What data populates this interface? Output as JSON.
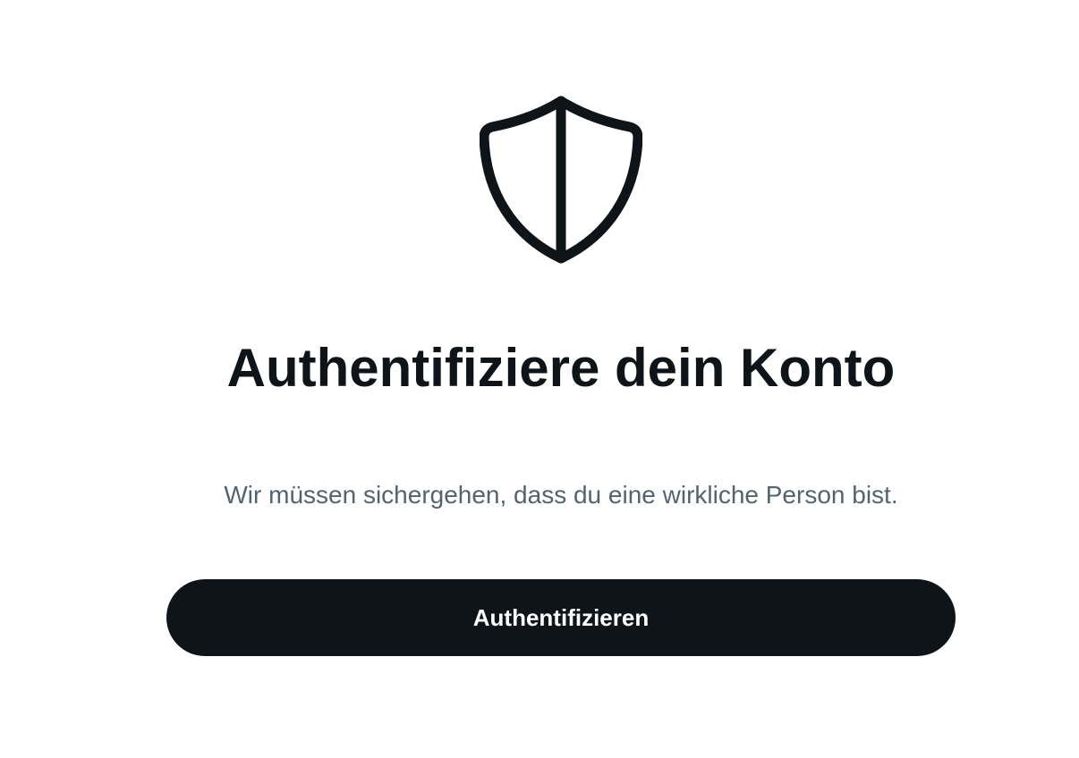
{
  "icon": {
    "name": "shield-icon",
    "color": "#0f1419"
  },
  "title": "Authentifiziere dein Konto",
  "subtitle": "Wir müssen sichergehen, dass du eine wirkliche Person bist.",
  "button": {
    "label": "Authentifizieren",
    "background": "#0f1419",
    "text_color": "#ffffff"
  },
  "colors": {
    "title": "#0f1419",
    "subtitle": "#536471",
    "background": "#ffffff"
  }
}
